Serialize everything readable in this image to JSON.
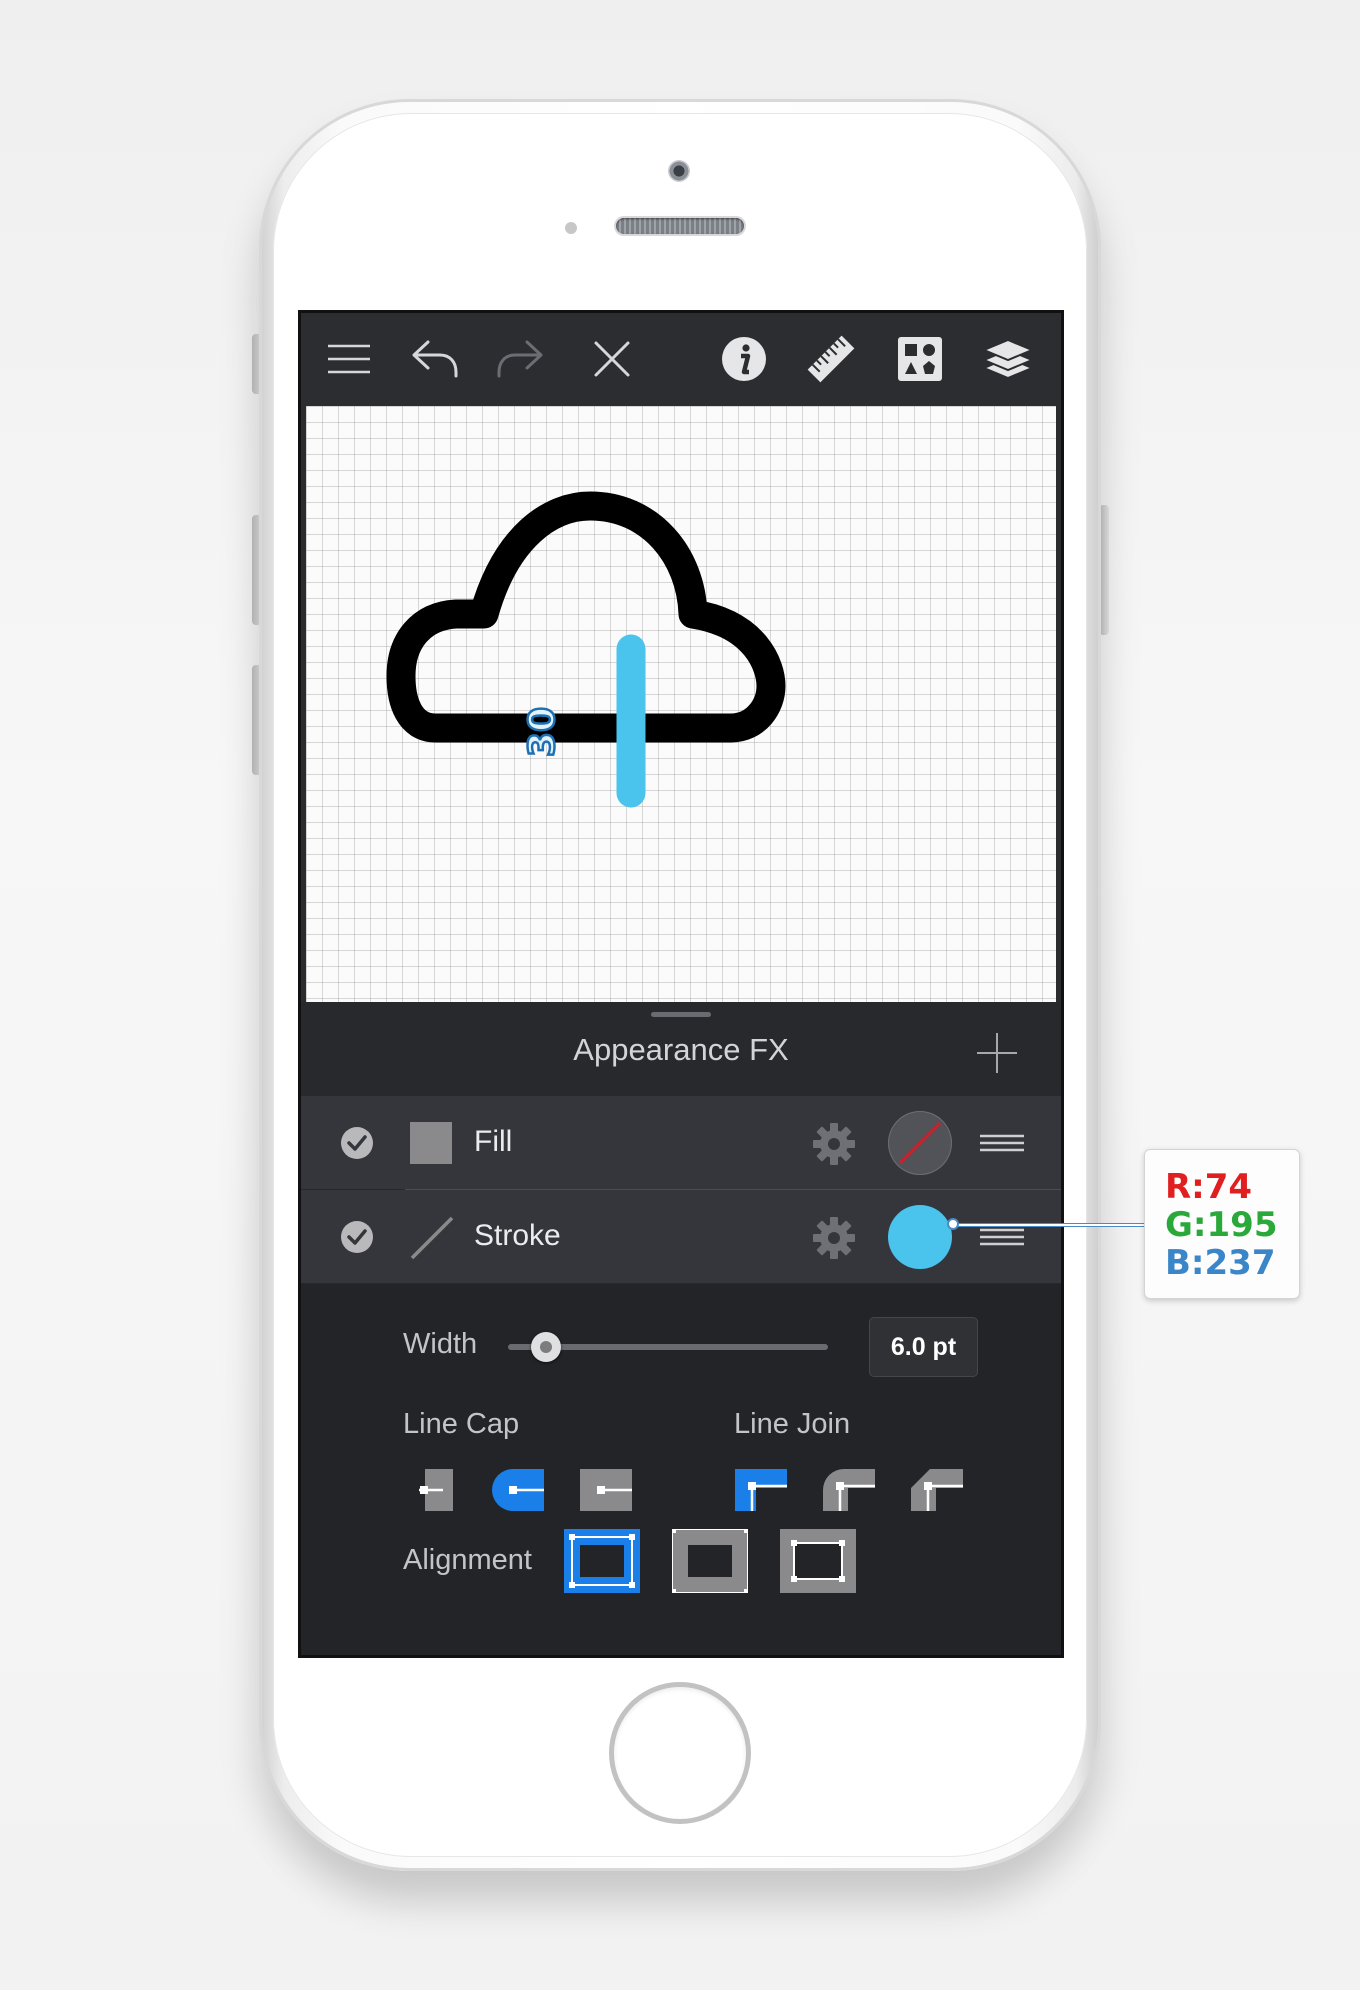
{
  "app": {
    "toolbar": {
      "icons": [
        "menu-icon",
        "undo-icon",
        "redo-icon",
        "close-icon",
        "info-icon",
        "ruler-icon",
        "library-icon",
        "layers-icon"
      ]
    },
    "canvas": {
      "angle_label": "30",
      "shapes": [
        "cloud-outline",
        "vertical-stroke-line"
      ]
    },
    "panel": {
      "title": "Appearance FX",
      "add_icon": "plus-icon",
      "rows": [
        {
          "label": "Fill",
          "enabled": true,
          "swatch": "none"
        },
        {
          "label": "Stroke",
          "enabled": true,
          "swatch": "#4AC3ED"
        }
      ],
      "width": {
        "label": "Width",
        "value": "6.0 pt",
        "slider_fraction": 0.12
      },
      "line_cap": {
        "label": "Line Cap",
        "options": [
          "butt-cap",
          "round-cap",
          "projecting-cap"
        ],
        "selected": "round-cap"
      },
      "line_join": {
        "label": "Line Join",
        "options": [
          "miter-join",
          "round-join",
          "bevel-join"
        ],
        "selected": "miter-join"
      },
      "alignment": {
        "label": "Alignment",
        "options": [
          "align-inside",
          "align-center",
          "align-outside"
        ],
        "selected": "align-inside"
      }
    }
  },
  "callout": {
    "r": "R:74",
    "g": "G:195",
    "b": "B:237",
    "colors": {
      "r": "#e02020",
      "g": "#2aa83a",
      "b": "#3a86c8"
    }
  },
  "colors": {
    "accent": "#1a7fe8",
    "stroke_color": "#4AC3ED",
    "toolbar_bg": "#2c2d31",
    "panel_bg": "#28292d"
  }
}
